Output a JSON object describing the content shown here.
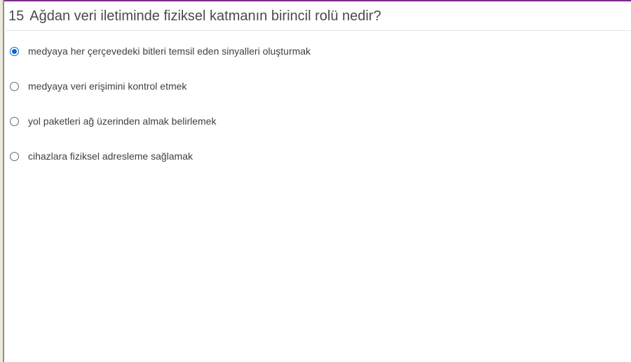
{
  "question": {
    "number": "15",
    "text": "Ağdan veri iletiminde fiziksel katmanın birincil rolü nedir?"
  },
  "answers": [
    {
      "label": "medyaya her çerçevedeki bitleri temsil eden sinyalleri oluşturmak",
      "selected": true
    },
    {
      "label": "medyaya veri erişimini kontrol etmek",
      "selected": false
    },
    {
      "label": "yol paketleri ağ üzerinden almak belirlemek",
      "selected": false
    },
    {
      "label": "cihazlara fiziksel adresleme sağlamak",
      "selected": false
    }
  ],
  "colors": {
    "accent": "#7b2a8c",
    "radio_selected": "#0a63c9"
  }
}
